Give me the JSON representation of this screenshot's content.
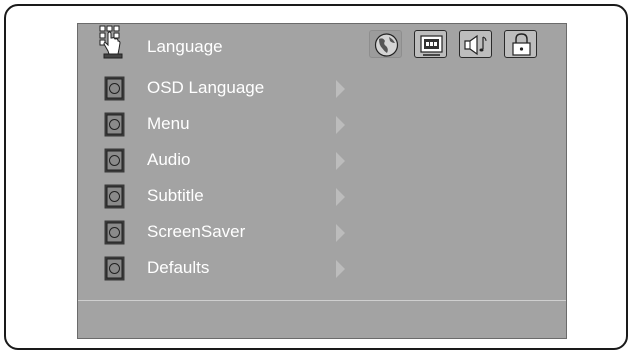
{
  "header": {
    "title": "Language",
    "tabs": [
      {
        "name": "language-tab",
        "icon": "globe-icon",
        "active": true
      },
      {
        "name": "video-tab",
        "icon": "tv-icon",
        "active": false
      },
      {
        "name": "audio-tab",
        "icon": "speaker-icon",
        "active": false
      },
      {
        "name": "lock-tab",
        "icon": "lock-icon",
        "active": false
      }
    ]
  },
  "menu": {
    "items": [
      {
        "label": "OSD Language"
      },
      {
        "label": "Menu"
      },
      {
        "label": "Audio"
      },
      {
        "label": "Subtitle"
      },
      {
        "label": "ScreenSaver"
      },
      {
        "label": "Defaults"
      }
    ]
  },
  "colors": {
    "panel": "#a3a3a3",
    "text": "#ffffff",
    "arrow": "#bcbcbc"
  }
}
